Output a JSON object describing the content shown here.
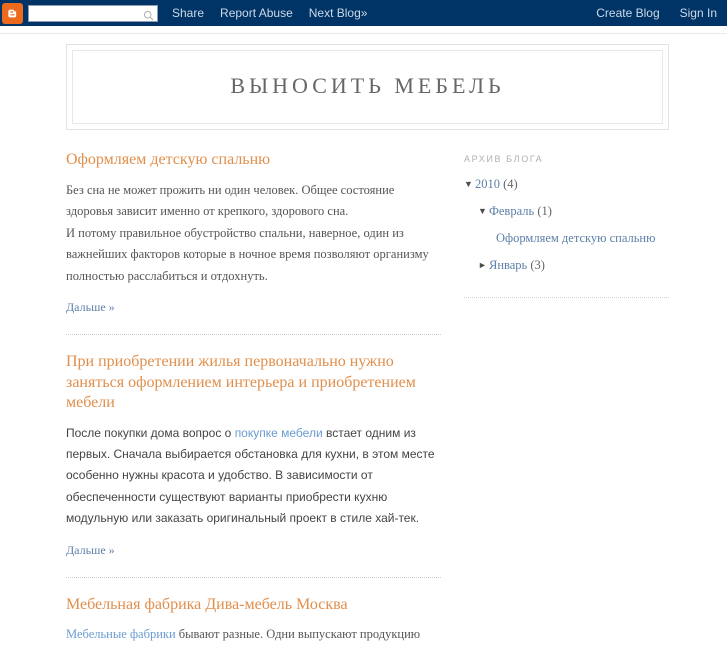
{
  "navbar": {
    "logo_icon": "blogger-b-logo",
    "search": {
      "value": "",
      "placeholder": "",
      "icon": "search-icon"
    },
    "links": [
      {
        "label": "Share"
      },
      {
        "label": "Report Abuse"
      },
      {
        "label": "Next Blog»"
      }
    ],
    "right_links": [
      {
        "label": "Create Blog"
      },
      {
        "label": "Sign In"
      }
    ],
    "background_color": "#003366",
    "logo_color": "#ec6a1e"
  },
  "header": {
    "blog_title": "ВЫНОСИТЬ МЕБЕЛЬ"
  },
  "posts": [
    {
      "title": "Оформляем детскую спальню",
      "body_1": "Без сна не может прожить ни один человек. Общее состояние здоровья зависит именно от крепкого, здорового сна.",
      "body_2": "И потому правильное обустройство спальни, наверное, один из важнейших факторов которые в ночное время позволяют организму полностью расслабиться и отдохнуть.",
      "more_label": "Дальше »"
    },
    {
      "title": "При приобретении жилья первоначально нужно заняться оформлением интерьера и приобретением мебели",
      "body_before_link": "После покупки дома вопрос о ",
      "body_link": "покупке мебели",
      "body_after_link": " встает одним из первых. Сначала выбирается обстановка для кухни, в этом месте особенно нужны красота и удобство. В зависимости от обеспеченности существуют варианты приобрести кухню модульную или заказать оригинальный проект в стиле хай-тек.",
      "more_label": "Дальше »"
    },
    {
      "title": "Мебельная фабрика Дива-мебель Москва",
      "body_link": "Мебельные фабрики",
      "body_after_link": " бывают разные. Одни выпускают продукцию"
    }
  ],
  "sidebar": {
    "heading": "АРХИВ БЛОГА",
    "archive": [
      {
        "toggle": "▼",
        "label": "2010",
        "count": "(4)",
        "level": 1
      },
      {
        "toggle": "▼",
        "label": "Февраль",
        "count": "(1)",
        "level": 2
      },
      {
        "toggle": "",
        "label": "Оформляем детскую спальню",
        "count": "",
        "level": 3
      },
      {
        "toggle": "►",
        "label": "Январь",
        "count": "(3)",
        "level": 2
      }
    ]
  },
  "colors": {
    "navbar_bg": "#003366",
    "accent_orange": "#e08f4c",
    "link_blue": "#6a9bd1",
    "title_gray": "#666666"
  }
}
